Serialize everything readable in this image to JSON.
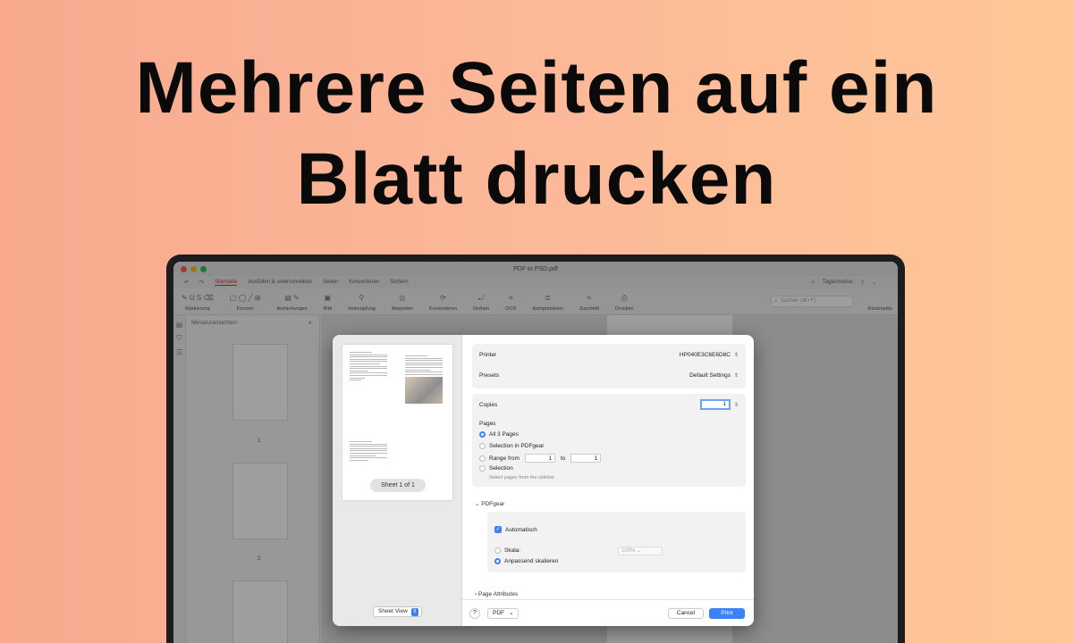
{
  "headline": {
    "line1": "Mehrere Seiten auf ein",
    "line2": "Blatt drucken"
  },
  "window": {
    "title": "PDF to PSD.pdf",
    "tabs": [
      "Startseite",
      "Ausfüllen & unterschreiben",
      "Seiten",
      "Konvertieren",
      "Sichern"
    ],
    "theme_label": "Tagesmodus",
    "toolbar_groups": [
      "Markierung",
      "Formen",
      "Anmerkungen",
      "Bild",
      "Verknüpfung",
      "Abspielen",
      "Konvertieren",
      "Drehen",
      "OCR",
      "Komprimieren",
      "Zuschnitt",
      "Drucken"
    ],
    "search_placeholder": "Suchen (⌘+F)",
    "feedback_label": "Rückmeldu"
  },
  "sidebar": {
    "title": "Miniaturansichten",
    "page_numbers": [
      "1",
      "2"
    ]
  },
  "dialog": {
    "sheet_label": "Sheet 1 of 1",
    "sheet_view_label": "Sheet View",
    "printer_label": "Printer",
    "printer_value": "HP040E3C6E6D8C",
    "presets_label": "Presets",
    "presets_value": "Default Settings",
    "copies_label": "Copies",
    "copies_value": "1",
    "pages_label": "Pages",
    "page_options": {
      "all": "All 3 Pages",
      "selection_in": "Selection in PDFgear",
      "range_from": "Range from",
      "range_to": "to",
      "range_start": "1",
      "range_end": "1",
      "selection": "Selection",
      "selection_hint": "Select pages from the sidebar"
    },
    "pdfgear_section": "PDFgear",
    "auto_label": "Automatisch",
    "scale_label": "Skala:",
    "scale_value": "100%",
    "fit_label": "Anpassend skalieren",
    "page_attributes": "Page Attributes",
    "help": "?",
    "pdf_button": "PDF",
    "cancel_button": "Cancel",
    "print_button": "Print"
  },
  "colors": {
    "accent": "#3b82f6",
    "tab_active": "#c0392b"
  }
}
